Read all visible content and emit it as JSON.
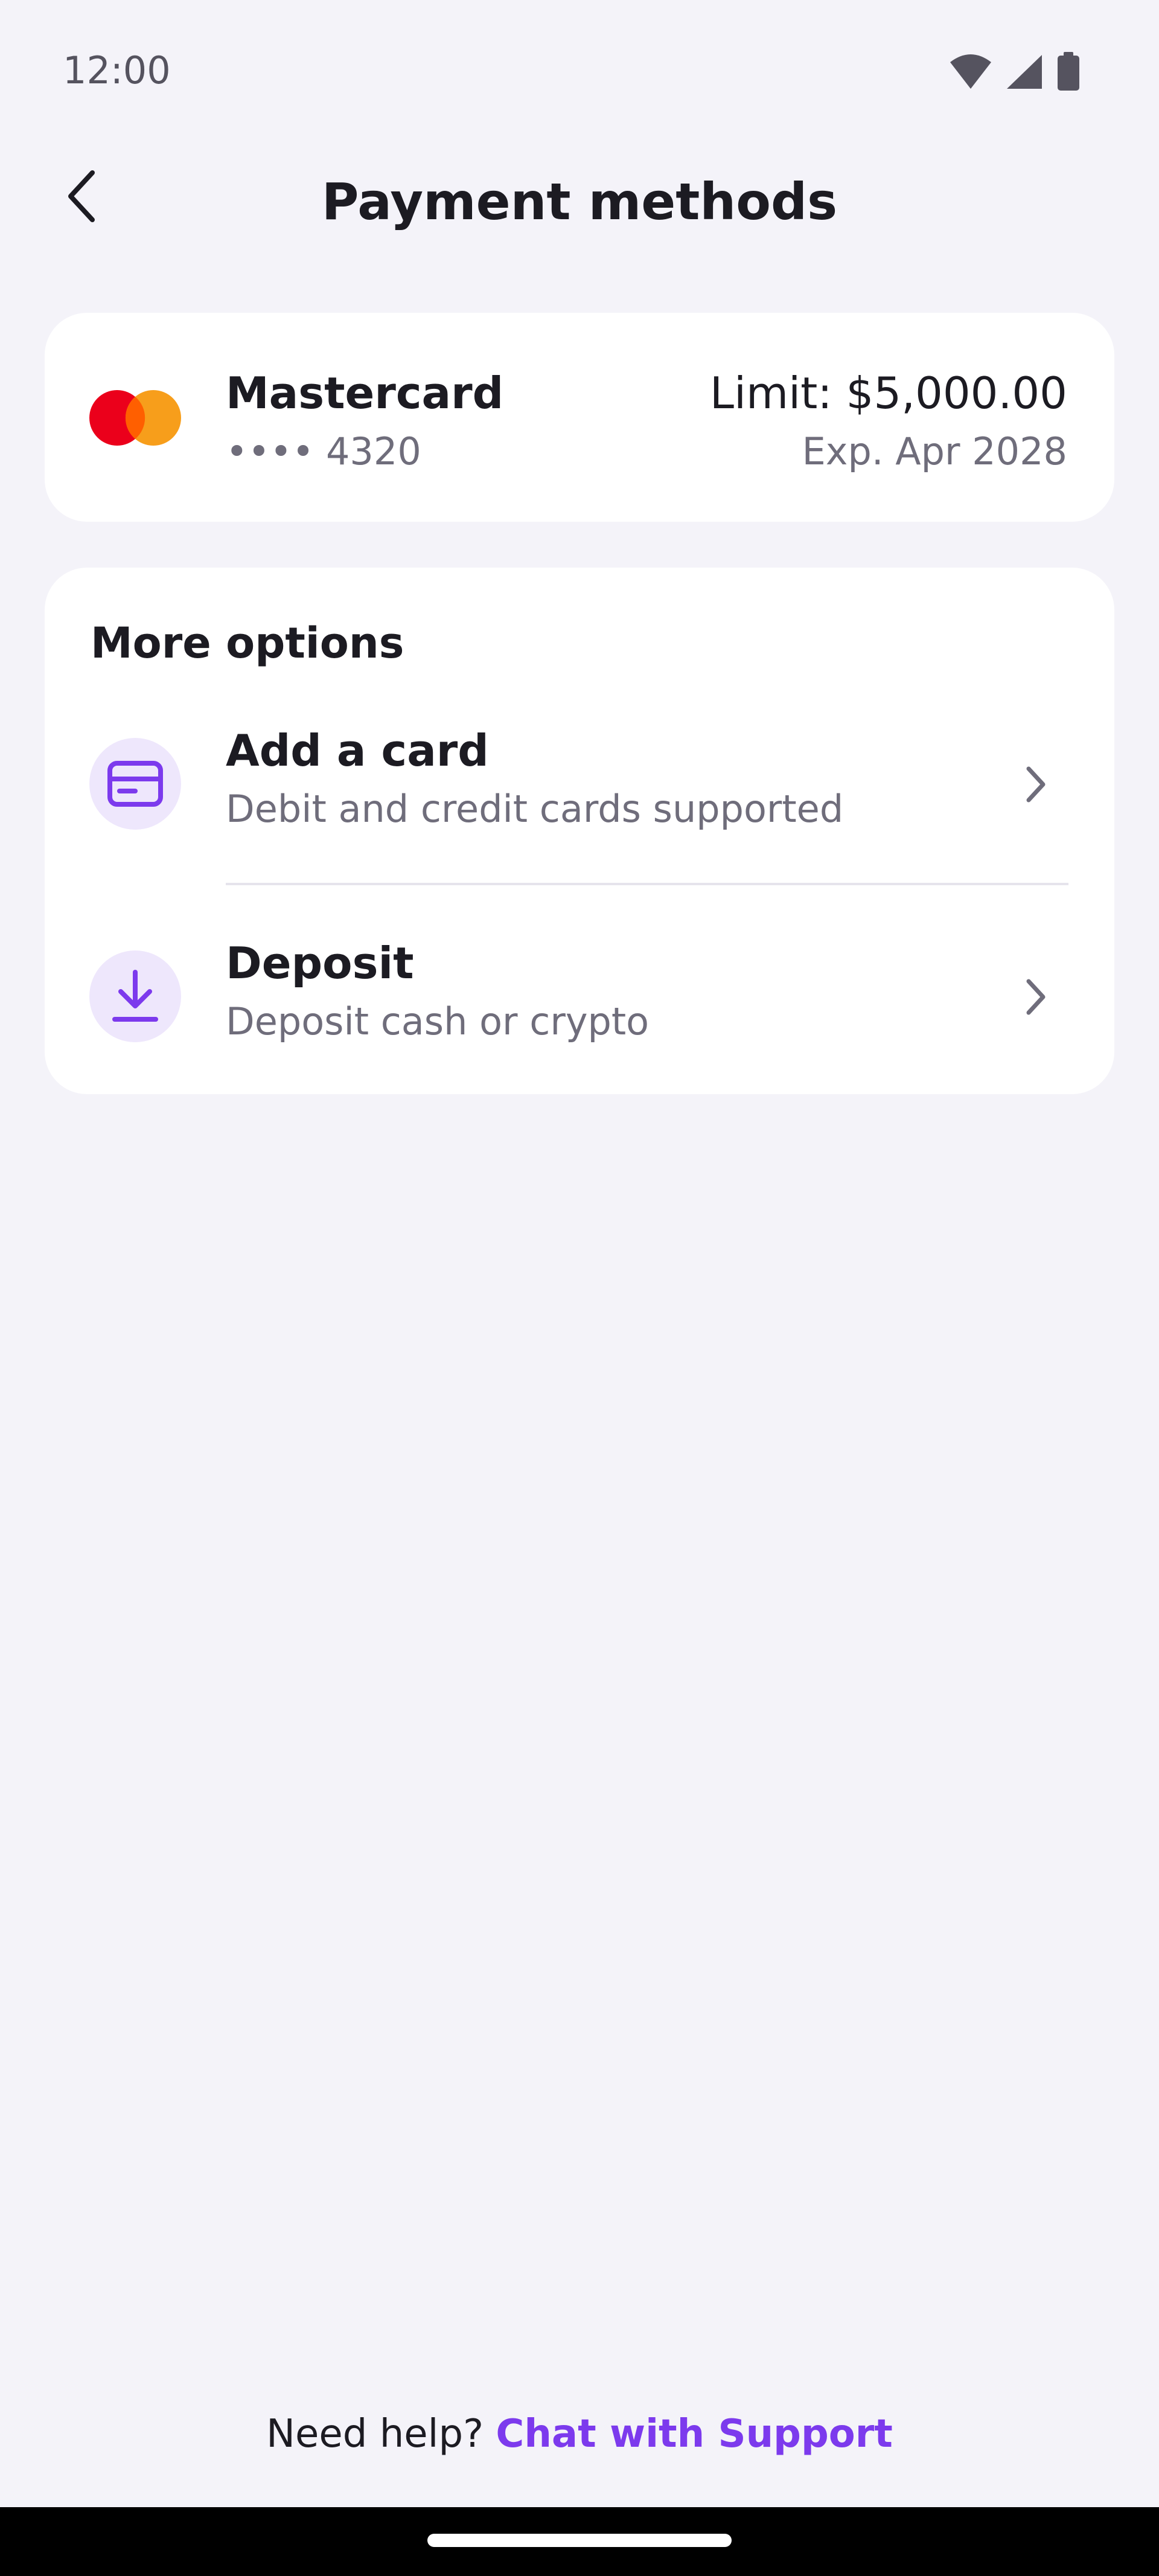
{
  "status_bar": {
    "time": "12:00",
    "icons": [
      "wifi-icon",
      "signal-icon",
      "battery-icon"
    ]
  },
  "header": {
    "back_icon": "chevron-left-icon",
    "title": "Payment methods"
  },
  "saved_card": {
    "brand": "Mastercard",
    "number_masked": "•••• 4320",
    "limit": "Limit: $5,000.00",
    "expiry": "Exp. Apr 2028",
    "logo_colors": {
      "left": "#EB001B",
      "right": "#F79E1B",
      "overlap": "#FF5F00"
    }
  },
  "more_options": {
    "heading": "More options",
    "items": [
      {
        "icon": "credit-card-icon",
        "title": "Add a card",
        "subtitle": "Debit and credit cards supported"
      },
      {
        "icon": "download-icon",
        "title": "Deposit",
        "subtitle": "Deposit cash or crypto"
      }
    ]
  },
  "help": {
    "prompt": "Need help?",
    "link": "Chat with Support"
  },
  "colors": {
    "background": "#F4F3F9",
    "card": "#FFFFFF",
    "accent": "#7C3AED",
    "icon_bg": "#EEE7FC",
    "secondary_text": "#6F6D7B"
  }
}
